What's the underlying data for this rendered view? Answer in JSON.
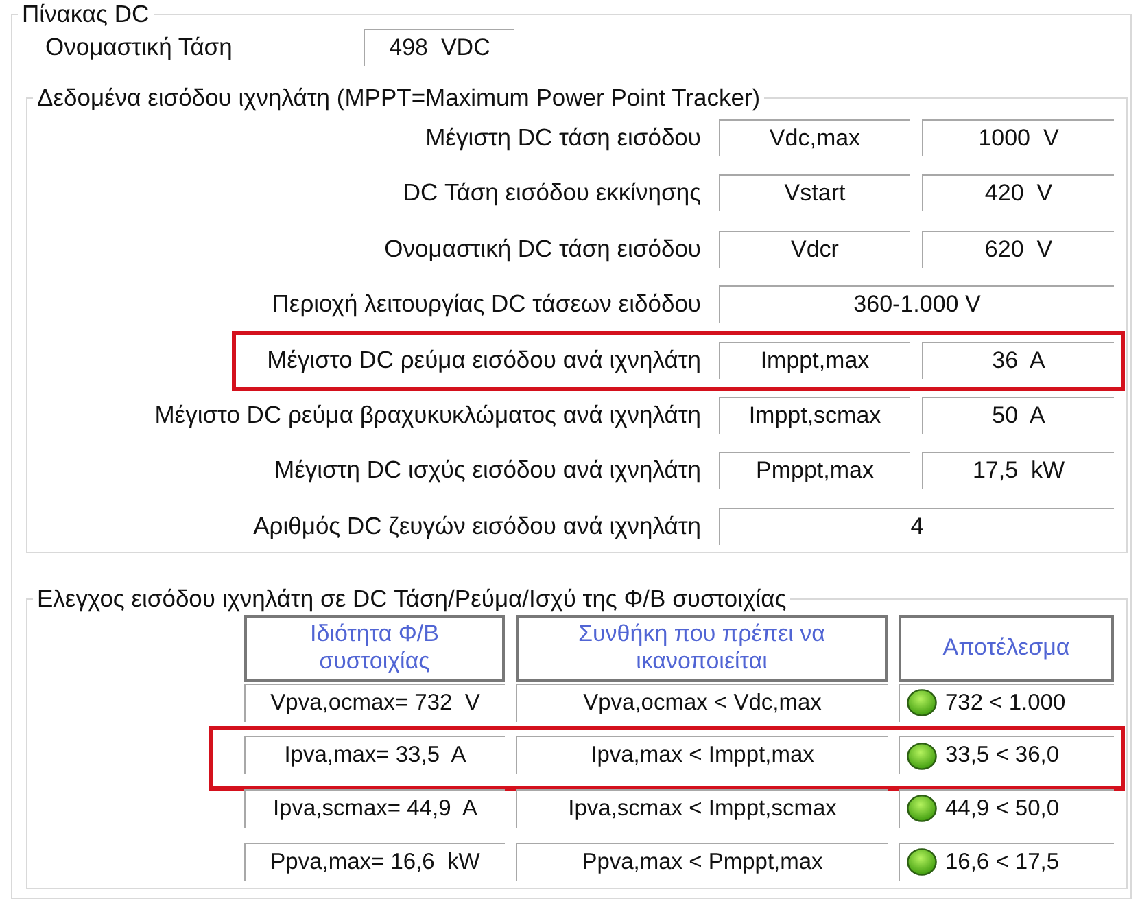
{
  "panel": {
    "title": "Πίνακας DC",
    "rated_voltage": {
      "label": "Ονομαστική Τάση",
      "value": "498  VDC"
    }
  },
  "tracker_input": {
    "title": "Δεδομένα εισόδου ιχνηλάτη (MPPT=Maximum Power Point Tracker)",
    "rows": [
      {
        "kind": "split",
        "label": "Μέγιστη DC τάση εισόδου",
        "symbol": "Vdc,max",
        "value": "1000  V",
        "highlighted": false
      },
      {
        "kind": "split",
        "label": "DC Τάση εισόδου εκκίνησης",
        "symbol": "Vstart",
        "value": "420  V",
        "highlighted": false
      },
      {
        "kind": "split",
        "label": "Ονομαστική DC τάση εισόδου",
        "symbol": "Vdcr",
        "value": "620  V",
        "highlighted": false
      },
      {
        "kind": "merged",
        "label": "Περιοχή λειτουργίας DC τάσεων ειδόδου",
        "value": "360-1.000 V",
        "highlighted": false
      },
      {
        "kind": "split",
        "label": "Μέγιστο DC ρεύμα εισόδου ανά ιχνηλάτη",
        "symbol": "Imppt,max",
        "value": "36  A",
        "highlighted": true
      },
      {
        "kind": "split",
        "label": "Μέγιστο DC ρεύμα βραχυκυκλώματος ανά ιχνηλάτη",
        "symbol": "Imppt,scmax",
        "value": "50  A",
        "highlighted": false
      },
      {
        "kind": "split",
        "label": "Μέγιστη DC ισχύς εισόδου ανά ιχνηλάτη",
        "symbol": "Pmppt,max",
        "value": "17,5  kW",
        "highlighted": false
      },
      {
        "kind": "merged",
        "label": "Αριθμός DC ζευγών εισόδου ανά ιχνηλάτη",
        "value": "4",
        "highlighted": false
      }
    ]
  },
  "input_check": {
    "title": "Ελεγχος εισόδου ιχνηλάτη σε DC Τάση/Ρεύμα/Ισχύ της Φ/Β συστοιχίας",
    "columns": [
      "Ιδιότητα Φ/Β συστοιχίας",
      "Συνθήκη που πρέπει να ικανοποιείται",
      "Αποτέλεσμα"
    ],
    "rows": [
      {
        "property": "Vpva,ocmax= 732  V",
        "condition": "Vpva,ocmax < Vdc,max",
        "passed": true,
        "result": "732 < 1.000",
        "highlighted": false
      },
      {
        "property": "Ipva,max= 33,5  A",
        "condition": "Ipva,max < Imppt,max",
        "passed": true,
        "result": "33,5 < 36,0",
        "highlighted": true
      },
      {
        "property": "Ipva,scmax= 44,9  A",
        "condition": "Ipva,scmax < Imppt,scmax",
        "passed": true,
        "result": "44,9 < 50,0",
        "highlighted": false
      },
      {
        "property": "Ppva,max= 16,6  kW",
        "condition": "Ppva,max < Pmppt,max",
        "passed": true,
        "result": "16,6 < 17,5",
        "highlighted": false
      }
    ]
  }
}
